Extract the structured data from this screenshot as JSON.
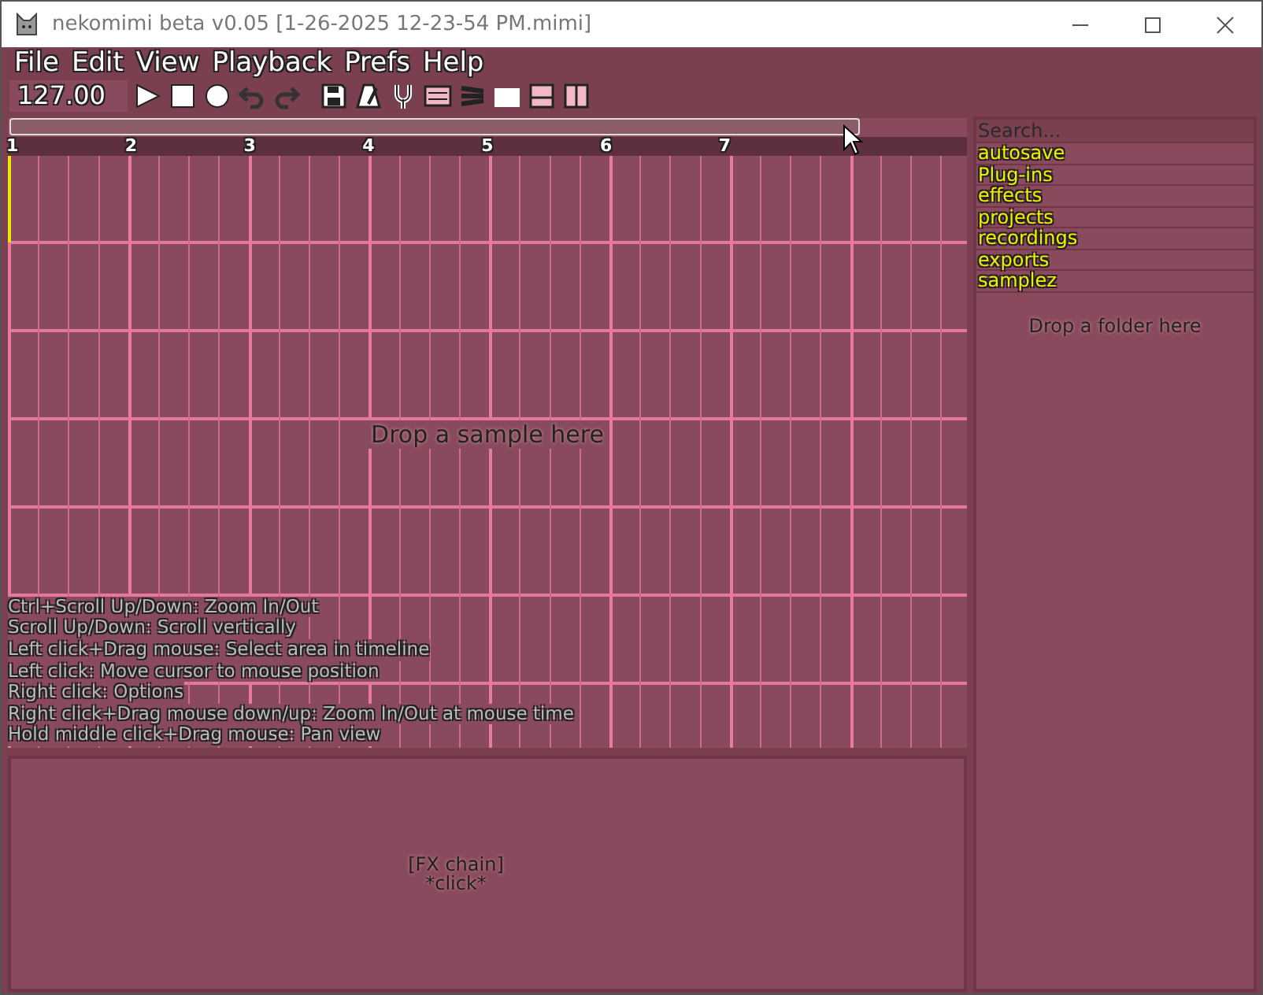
{
  "window": {
    "title": "nekomimi beta v0.05 [1-26-2025 12-23-54 PM.mimi]"
  },
  "menu": [
    "File",
    "Edit",
    "View",
    "Playback",
    "Prefs",
    "Help"
  ],
  "toolbar": {
    "tempo": "127.00"
  },
  "ruler": [
    "1",
    "2",
    "3",
    "4",
    "5",
    "6",
    "7"
  ],
  "timeline": {
    "drop_hint": "Drop a sample here",
    "help": [
      "Ctrl+Scroll Up/Down: Zoom In/Out",
      "Scroll Up/Down: Scroll vertically",
      "Left click+Drag mouse: Select area in timeline",
      "Left click: Move cursor to mouse position",
      "Right click: Options",
      "Right click+Drag mouse down/up: Zoom In/Out at mouse time",
      "Hold middle click+Drag mouse: Pan view"
    ]
  },
  "fx_panel": {
    "lines": [
      "[FX chain]",
      "*click*"
    ]
  },
  "browser": {
    "search": {
      "placeholder": "Search..."
    },
    "folders": [
      "autosave",
      "Plug-ins",
      "effects",
      "projects",
      "recordings",
      "exports",
      "samplez"
    ],
    "drop_hint": "Drop a folder here"
  }
}
